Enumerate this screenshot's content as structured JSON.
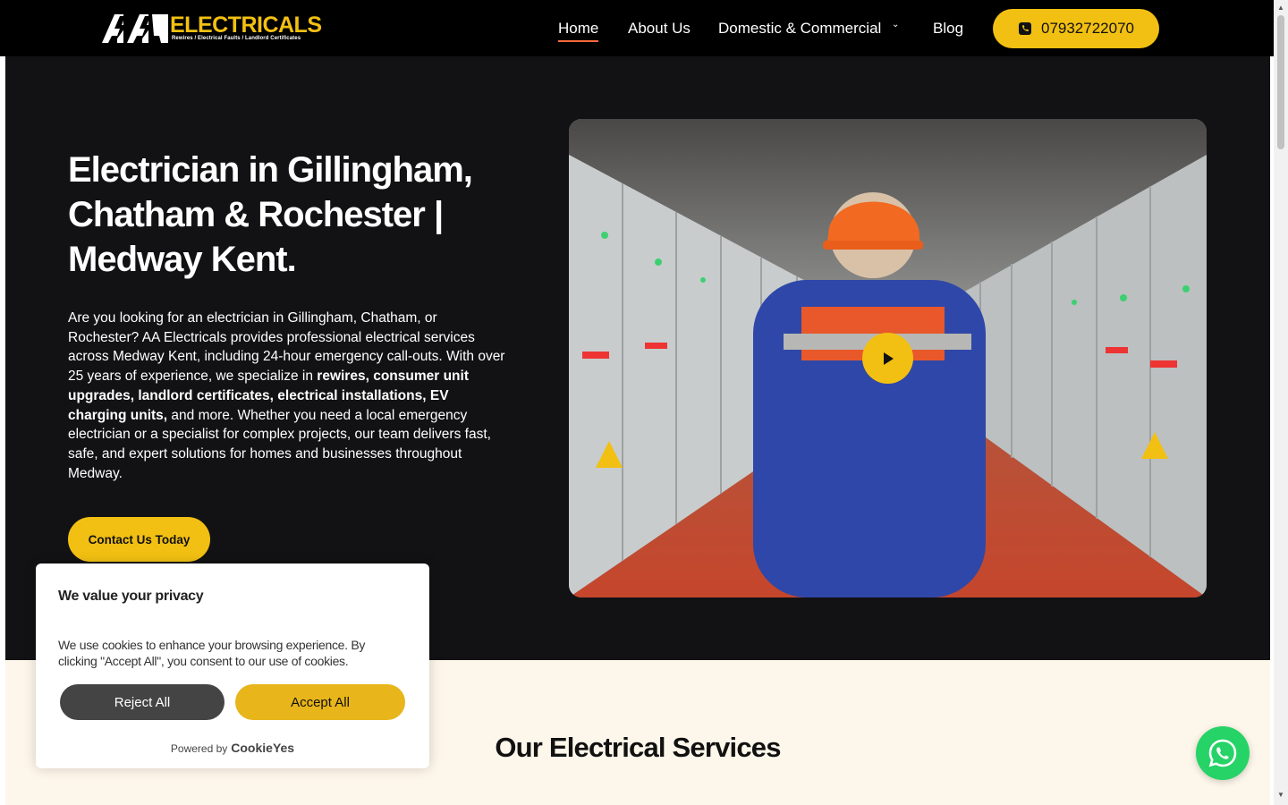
{
  "header": {
    "logo_word": "ELECTRICALS",
    "logo_tag": "Rewires / Electrical Faults / Landlord Certificates",
    "nav": {
      "home": "Home",
      "about": "About Us",
      "domestic": "Domestic & Commercial",
      "blog": "Blog"
    },
    "phone": "07932722070",
    "phone_icon": "phone-icon"
  },
  "hero": {
    "title": "Electrician in Gillingham, Chatham & Rochester | Medway Kent.",
    "text_1": "Are you looking for an electrician in Gillingham, Chatham, or Rochester? AA Electricals provides professional electrical services across Medway Kent, including 24-hour emergency call-outs. With over 25 years of experience, we specialize in ",
    "text_bold": "rewires, consumer unit upgrades, landlord certificates, electrical installations, EV charging units,",
    "text_2": " and more. Whether you need a local emergency electrician or a specialist for complex projects, our team delivers fast, safe, and expert solutions for homes and businesses throughout Medway.",
    "cta": "Contact Us Today",
    "video_icon": "play-icon"
  },
  "services": {
    "title": "Our Electrical Services"
  },
  "cookie": {
    "title": "We value your privacy",
    "text": "We use cookies to enhance your browsing experience. By clicking \"Accept All\", you consent to our use of cookies.",
    "reject": "Reject All",
    "accept": "Accept All",
    "powered_by": "Powered by",
    "brand": "CookieYes"
  },
  "colors": {
    "accent": "#f2c012",
    "header_bg": "#000000",
    "hero_bg": "#121214",
    "services_bg": "#fdf6ea",
    "whatsapp": "#25d366"
  }
}
